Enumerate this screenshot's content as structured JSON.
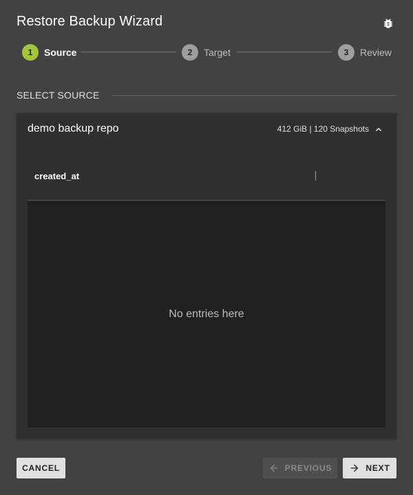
{
  "dialog": {
    "title": "Restore Backup Wizard",
    "bug_icon": "bug-icon"
  },
  "stepper": {
    "steps": [
      {
        "number": "1",
        "label": "Source",
        "active": true
      },
      {
        "number": "2",
        "label": "Target",
        "active": false
      },
      {
        "number": "3",
        "label": "Review",
        "active": false
      }
    ],
    "active_color": "#a4c639",
    "inactive_color": "#9e9e9e"
  },
  "section": {
    "title": "SELECT SOURCE"
  },
  "repo": {
    "name": "demo backup repo",
    "meta": "412 GiB | 120 Snapshots",
    "chevron_icon": "chevron-up-icon"
  },
  "table": {
    "columns": [
      "created_at",
      ""
    ],
    "empty_text": "No entries here"
  },
  "footer": {
    "cancel_label": "CANCEL",
    "previous_label": "PREVIOUS",
    "previous_icon": "arrow-left-icon",
    "next_label": "NEXT",
    "next_icon": "arrow-right-icon"
  }
}
